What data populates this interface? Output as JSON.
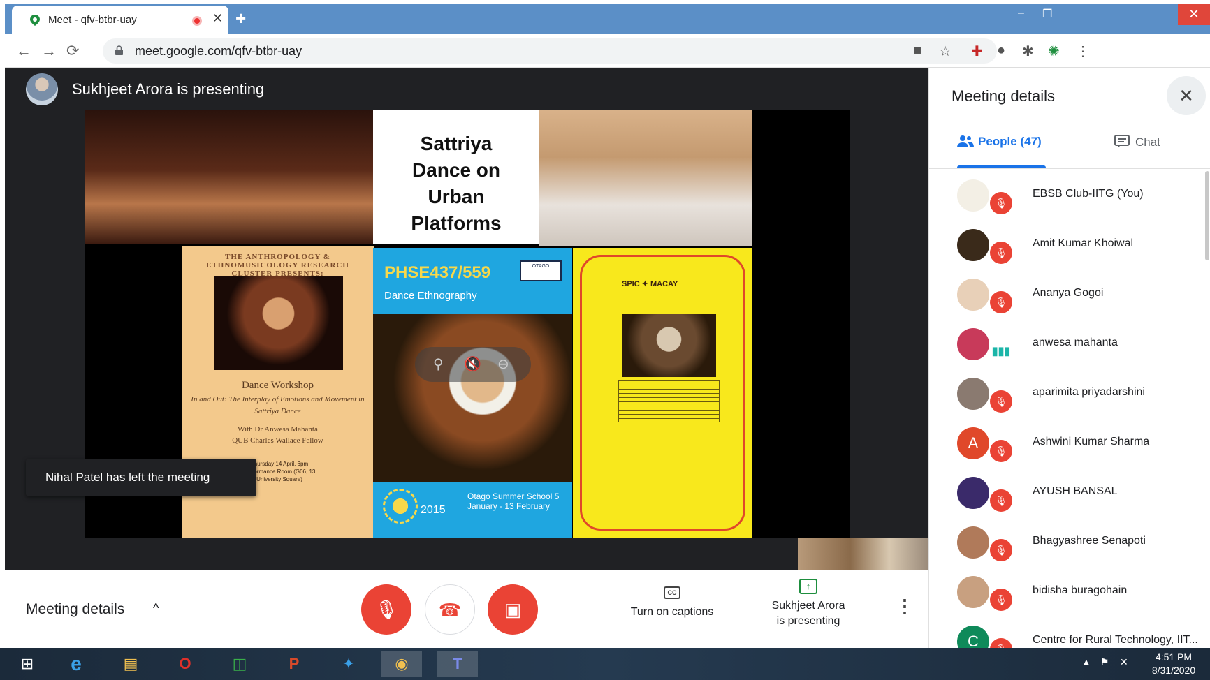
{
  "browser": {
    "tab_title": "Meet - qfv-btbr-uay",
    "tab_close": "✕",
    "new_tab": "+",
    "url": "meet.google.com/qfv-btbr-uay",
    "back": "←",
    "forward": "→",
    "reload": "⟳",
    "min": "–",
    "max": "❐",
    "close": "✕",
    "toolbar_icons": [
      "camera-icon",
      "star-icon",
      "pdf-icon",
      "extension-circle-icon",
      "puzzle-icon",
      "profile-icon",
      "menu-icon"
    ],
    "icon_glyphs": [
      "■",
      "☆",
      "✚",
      "●",
      "✱",
      "✺",
      "⋮"
    ]
  },
  "stage": {
    "presenting_title": "Sukhjeet Arora is presenting",
    "toast": "Nihal Patel has left the meeting"
  },
  "slide": {
    "title_lines": [
      "Sattriya",
      "Dance on",
      "Urban",
      "Platforms"
    ],
    "poster_left": {
      "header": "THE ANTHROPOLOGY & ETHNOMUSICOLOGY RESEARCH CLUSTER PRESENTS:",
      "title": "Dance Workshop",
      "subtitle": "In and Out: The Interplay of Emotions and Movement in Sattriya Dance",
      "with": "With Dr Anwesa Mahanta",
      "fellow": "QUB Charles Wallace Fellow",
      "box": "Thursday 14 April, 6pm Performance Room (G06, 13 University Square)"
    },
    "poster_mid": {
      "code": "PHSE437/559",
      "sub": "Dance Ethnography",
      "logo": "OTAGO",
      "year": "2015",
      "school": "Otago Summer School 5 January - 13 February"
    },
    "poster_right": {
      "head": "SPIC ✦ MACAY"
    }
  },
  "hover_controls": [
    "pin-icon",
    "mute-icon",
    "remove-icon"
  ],
  "hover_glyphs": [
    "⚲",
    "🔇",
    "⊖"
  ],
  "bottombar": {
    "details_label": "Meeting details",
    "chevron": "^",
    "mic_glyph": "🎙",
    "hang_glyph": "☎",
    "cam_glyph": "▣",
    "cc": "CC",
    "captions_label": "Turn on captions",
    "present_glyph": "↑",
    "presenting_line1": "Sukhjeet Arora",
    "presenting_line2": "is presenting",
    "more": "⋮"
  },
  "panel": {
    "title": "Meeting details",
    "close": "✕",
    "tab_people": "People (47)",
    "tab_chat": "Chat",
    "people": [
      {
        "name": "EBSB Club-IITG (You)",
        "initial": "",
        "color": "#f3efe5",
        "mic": "muted"
      },
      {
        "name": "Amit Kumar Khoiwal",
        "initial": "",
        "color": "#3a2a1a",
        "mic": "muted"
      },
      {
        "name": "Ananya Gogoi",
        "initial": "",
        "color": "#e8d0b8",
        "mic": "muted"
      },
      {
        "name": "anwesa mahanta",
        "initial": "",
        "color": "#c83a5a",
        "mic": "speaking"
      },
      {
        "name": "aparimita priyadarshini",
        "initial": "",
        "color": "#8a7a70",
        "mic": "muted"
      },
      {
        "name": "Ashwini Kumar Sharma",
        "initial": "A",
        "color": "#e0482a",
        "mic": "muted"
      },
      {
        "name": "AYUSH BANSAL",
        "initial": "",
        "color": "#3a2a6a",
        "mic": "muted"
      },
      {
        "name": "Bhagyashree Senapoti",
        "initial": "",
        "color": "#b07a5a",
        "mic": "muted"
      },
      {
        "name": "bidisha buragohain",
        "initial": "",
        "color": "#c8a080",
        "mic": "muted"
      },
      {
        "name": "Centre for Rural Technology, IIT...",
        "initial": "C",
        "color": "#0f8a5a",
        "mic": "muted"
      }
    ]
  },
  "taskbar": {
    "apps": [
      "windows-start-icon",
      "internet-explorer-icon",
      "file-explorer-icon",
      "opera-icon",
      "store-icon",
      "powerpoint-icon",
      "app-bird-icon",
      "chrome-icon",
      "teams-icon"
    ],
    "glyphs": [
      "⊞",
      "e",
      "▤",
      "O",
      "◫",
      "P",
      "✦",
      "◉",
      "T"
    ],
    "time": "4:51 PM",
    "date": "8/31/2020"
  }
}
